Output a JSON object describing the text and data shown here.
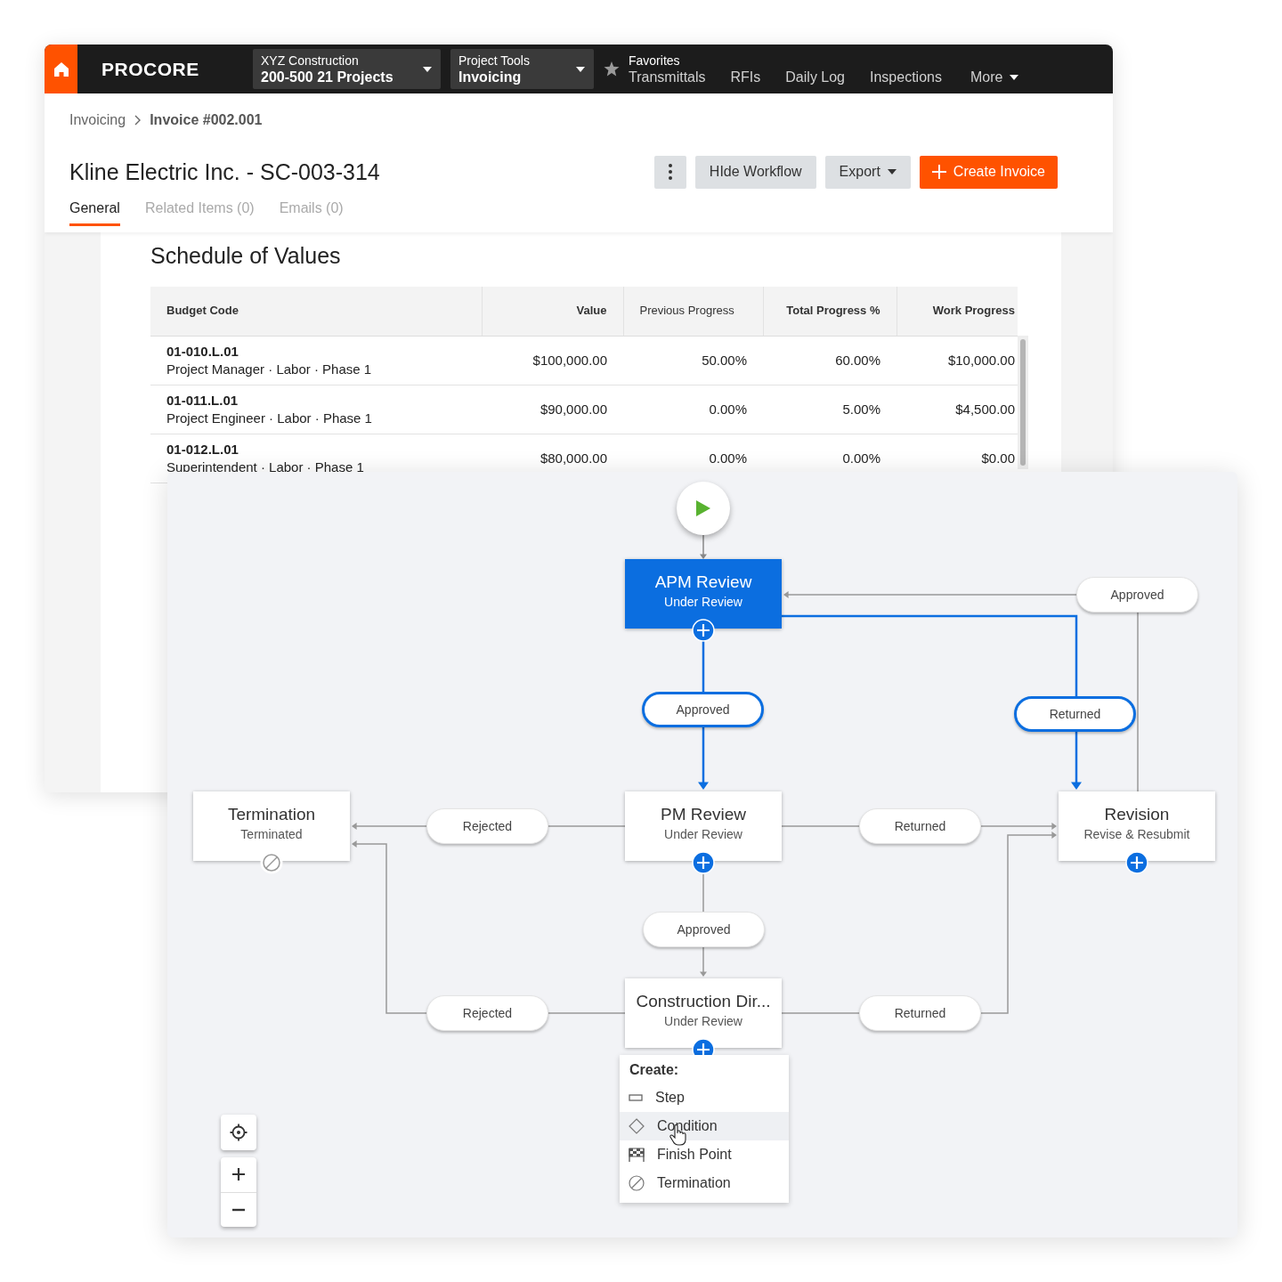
{
  "logo": "PROCORE",
  "nav": {
    "project": {
      "label": "XYZ Construction",
      "value": "200-500 21 Projects"
    },
    "tool": {
      "label": "Project Tools",
      "value": "Invoicing"
    },
    "favorites_label": "Favorites",
    "links": [
      "Transmittals",
      "RFIs",
      "Daily Log",
      "Inspections"
    ],
    "more": "More"
  },
  "breadcrumb": [
    {
      "label": "Invoicing",
      "current": false
    },
    {
      "label": "Invoice #002.001",
      "current": true
    }
  ],
  "title": "Kline Electric Inc. - SC-003-314",
  "actions": [
    {
      "kind": "menu"
    },
    {
      "kind": "secondary",
      "label": "HIde Workflow"
    },
    {
      "kind": "dropdown",
      "label": "Export"
    },
    {
      "kind": "primary",
      "label": "Create Invoice"
    }
  ],
  "tabs": [
    {
      "label": "General",
      "selected": true
    },
    {
      "label": "Related Items (0)",
      "selected": false
    },
    {
      "label": "Emails (0)",
      "selected": false
    }
  ],
  "section_title": "Schedule of Values",
  "table": {
    "columns": [
      "Budget Code",
      "Value",
      "Previous Progress",
      "Total Progress %",
      "Work Progress"
    ],
    "rows": [
      {
        "cells": [
          {
            "code": "01-010.L.01",
            "description": "Project Manager · Labor · Phase 1"
          },
          "$100,000.00",
          "50.00%",
          "60.00%",
          "$10,000.00"
        ]
      },
      {
        "cells": [
          {
            "code": "01-011.L.01",
            "description": "Project Engineer · Labor · Phase 1"
          },
          "$90,000.00",
          "0.00%",
          "5.00%",
          "$4,500.00"
        ]
      },
      {
        "cells": [
          {
            "code": "01-012.L.01",
            "description": "Superintendent · Labor · Phase 1"
          },
          "$80,000.00",
          "0.00%",
          "0.00%",
          "$0.00"
        ]
      }
    ]
  },
  "workflow": {
    "nodes": [
      {
        "kind": "start",
        "selected": false
      },
      {
        "kind": "step",
        "title": "APM Review",
        "status": "Under Review",
        "selected": true
      },
      {
        "kind": "termination",
        "title": "Termination",
        "status": "Terminated",
        "selected": false
      },
      {
        "kind": "step",
        "title": "PM Review",
        "status": "Under Review",
        "selected": false
      },
      {
        "kind": "step",
        "title": "Revision",
        "status": "Revise & Resubmit",
        "selected": false
      },
      {
        "kind": "step",
        "title": "Construction Dir...",
        "status": "Under Review",
        "selected": false
      }
    ],
    "transitions": [
      {
        "label": "Approved",
        "selected": false
      },
      {
        "label": "Approved",
        "selected": true
      },
      {
        "label": "Returned",
        "selected": true
      },
      {
        "label": "Rejected",
        "selected": false
      },
      {
        "label": "Returned",
        "selected": false
      },
      {
        "label": "Approved",
        "selected": false
      },
      {
        "label": "Rejected",
        "selected": false
      },
      {
        "label": "Returned",
        "selected": false
      }
    ],
    "menu": {
      "title": "Create:",
      "items": [
        {
          "kind": "step",
          "label": "Step",
          "selected": false
        },
        {
          "kind": "condition",
          "label": "Condition",
          "selected": true
        },
        {
          "kind": "finish",
          "label": "Finish Point",
          "selected": false
        },
        {
          "kind": "termination",
          "label": "Termination",
          "selected": false
        }
      ]
    }
  }
}
